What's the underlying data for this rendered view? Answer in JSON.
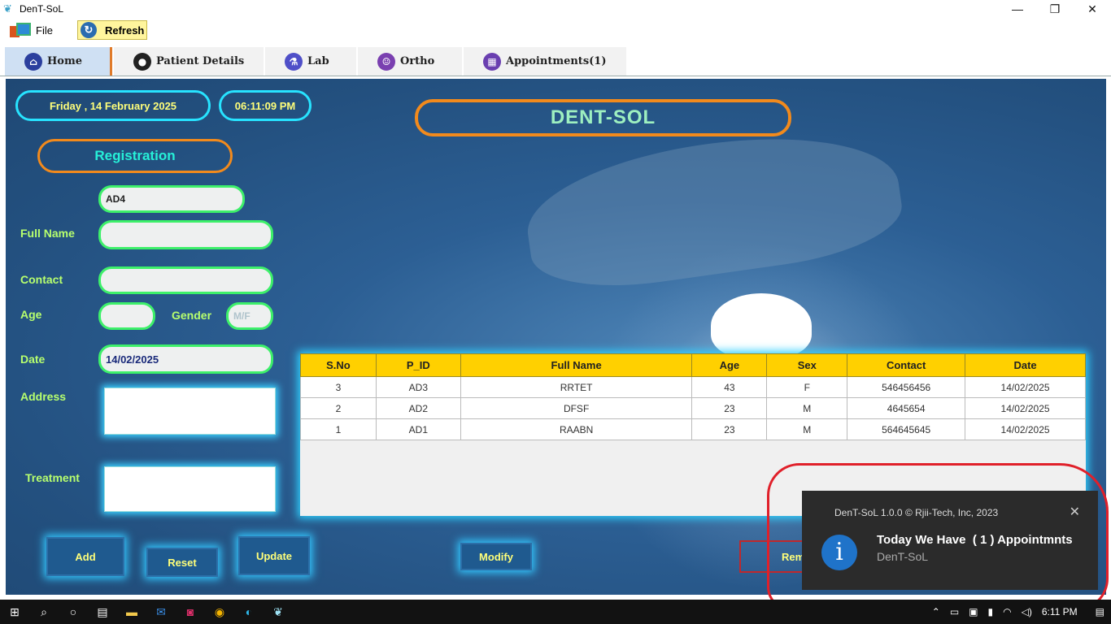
{
  "window": {
    "title": "DenT-SoL",
    "minimize": "—",
    "maximize": "❐",
    "close": "✕"
  },
  "menu": {
    "file_label": "File",
    "refresh_label": "Refresh"
  },
  "tabs": [
    {
      "label": "Home",
      "icon": "home-icon",
      "color": "#2b3f9e",
      "active": true
    },
    {
      "label": "Patient Details",
      "icon": "patient-icon",
      "color": "#222222"
    },
    {
      "label": "Lab",
      "icon": "lab-icon",
      "color": "#4f4fc8"
    },
    {
      "label": "Ortho",
      "icon": "ortho-icon",
      "color": "#7a3fb0"
    },
    {
      "label": "Appointments(1)",
      "icon": "calendar-icon",
      "color": "#6a3fb0"
    }
  ],
  "header": {
    "date": "Friday , 14 February 2025",
    "time": "06:11:09 PM",
    "brand": "DENT-SOL"
  },
  "form": {
    "section_title": "Registration",
    "id_value": "AD4",
    "full_name_label": "Full Name",
    "full_name_value": "",
    "contact_label": "Contact",
    "contact_value": "",
    "age_label": "Age",
    "age_value": "",
    "gender_label": "Gender",
    "gender_placeholder": "M/F",
    "date_label": "Date",
    "date_value": "14/02/2025",
    "address_label": "Address",
    "treatment_label": "Treatment"
  },
  "buttons": {
    "add": "Add",
    "reset": "Reset",
    "update": "Update",
    "modify": "Modify",
    "remove": "Rem"
  },
  "table": {
    "columns": [
      "S.No",
      "P_ID",
      "Full Name",
      "Age",
      "Sex",
      "Contact",
      "Date"
    ],
    "rows": [
      [
        "3",
        "AD3",
        "RRTET",
        "43",
        "F",
        "546456456",
        "14/02/2025"
      ],
      [
        "2",
        "AD2",
        "DFSF",
        "23",
        "M",
        "4645654",
        "14/02/2025"
      ],
      [
        "1",
        "AD1",
        "RAABN",
        "23",
        "M",
        "564645645",
        "14/02/2025"
      ]
    ]
  },
  "toast": {
    "header": "DenT-SoL 1.0.0 © Rjii-Tech, Inc, 2023",
    "message": "Today We Have  ( 1 ) Appointmnts",
    "app": "DenT-SoL",
    "close": "✕",
    "info_glyph": "i"
  },
  "taskbar": {
    "clock": "6:11 PM"
  }
}
